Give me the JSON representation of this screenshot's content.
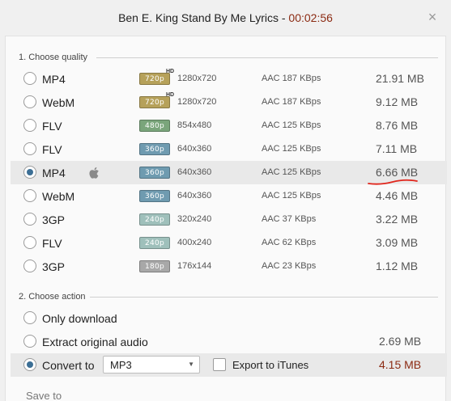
{
  "window": {
    "title": "Ben E. King Stand By Me Lyrics - ",
    "duration": "00:02:56",
    "close_glyph": "×"
  },
  "quality": {
    "heading": "1. Choose quality",
    "options": [
      {
        "format": "MP4",
        "badge": "720p",
        "hd": "HD",
        "resolution": "1280x720",
        "audio": "AAC 187 KBps",
        "size": "21.91 MB",
        "badge_color": "#b6a15a"
      },
      {
        "format": "WebM",
        "badge": "720p",
        "hd": "HD",
        "resolution": "1280x720",
        "audio": "AAC 187 KBps",
        "size": "9.12 MB",
        "badge_color": "#b6a15a"
      },
      {
        "format": "FLV",
        "badge": "480p",
        "hd": "",
        "resolution": "854x480",
        "audio": "AAC 125 KBps",
        "size": "8.76 MB",
        "badge_color": "#7aa57b"
      },
      {
        "format": "FLV",
        "badge": "360p",
        "hd": "",
        "resolution": "640x360",
        "audio": "AAC 125 KBps",
        "size": "7.11 MB",
        "badge_color": "#6f9bb0"
      },
      {
        "format": "MP4",
        "badge": "360p",
        "hd": "",
        "resolution": "640x360",
        "audio": "AAC 125 KBps",
        "size": "6.66 MB",
        "badge_color": "#6f9bb0",
        "apple": true,
        "selected": true
      },
      {
        "format": "WebM",
        "badge": "360p",
        "hd": "",
        "resolution": "640x360",
        "audio": "AAC 125 KBps",
        "size": "4.46 MB",
        "badge_color": "#6f9bb0"
      },
      {
        "format": "3GP",
        "badge": "240p",
        "hd": "",
        "resolution": "320x240",
        "audio": "AAC 37 KBps",
        "size": "3.22 MB",
        "badge_color": "#9fc0bb"
      },
      {
        "format": "FLV",
        "badge": "240p",
        "hd": "",
        "resolution": "400x240",
        "audio": "AAC 62 KBps",
        "size": "3.09 MB",
        "badge_color": "#9fc0bb"
      },
      {
        "format": "3GP",
        "badge": "180p",
        "hd": "",
        "resolution": "176x144",
        "audio": "AAC 23 KBps",
        "size": "1.12 MB",
        "badge_color": "#a8a8a8"
      }
    ]
  },
  "action": {
    "heading": "2. Choose action",
    "only_download": "Only download",
    "extract_audio": "Extract original audio",
    "extract_size": "2.69 MB",
    "convert_to": "Convert to",
    "convert_format": "MP3",
    "export_itunes": "Export to iTunes",
    "convert_size": "4.15 MB"
  },
  "save": {
    "label": "Save to"
  },
  "colors": {
    "accent": "#3c6f95",
    "time_red": "#8b2a12",
    "underline_red": "#e0251b"
  }
}
